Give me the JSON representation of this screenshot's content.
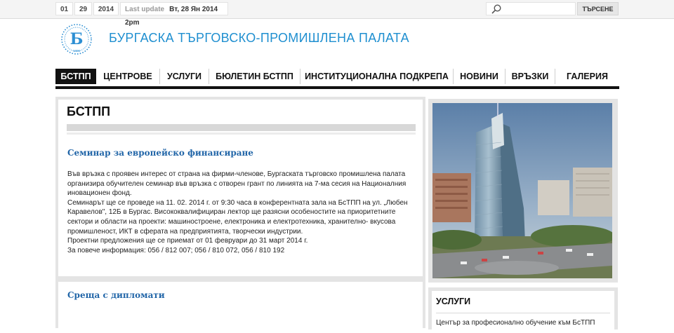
{
  "topbar": {
    "day": "01",
    "month": "29",
    "year": "2014",
    "last_update_label": "Last update",
    "last_update_value": "Вт, 28 Ян 2014 2pm",
    "search_placeholder": "",
    "search_button": "ТЪРСЕНЕ"
  },
  "header": {
    "site_title": "БУРГАСКА ТЪРГОВСКО-ПРОМИШЛЕНА ПАЛАТА",
    "logo_year": "1895"
  },
  "nav": {
    "items": [
      {
        "label": "БСТПП",
        "active": true
      },
      {
        "label": "ЦЕНТРОВЕ"
      },
      {
        "label": "УСЛУГИ"
      },
      {
        "label": "БЮЛЕТИН БСТПП"
      },
      {
        "label": "ИНСТИТУЦИОНАЛНА ПОДКРЕПА"
      },
      {
        "label": "НОВИНИ"
      },
      {
        "label": "ВРЪЗКИ"
      },
      {
        "label": "ГАЛЕРИЯ"
      }
    ]
  },
  "main": {
    "page_title": "БСТПП",
    "articles": [
      {
        "title": "Семинар за европейско финансиране",
        "body_lines": [
          "Във връзка с проявен интерес от страна на фирми-членове, Бургаската търговско промишлена палата",
          "организира обучителен семинар във връзка с отворен грант по линията на 7-ма сесия на Националния",
          "иновационен фонд.",
          "Семинарът ще се проведе на 11. 02. 2014 г. от 9:30 часа в конферентната зала на БсТПП на ул. „Любен",
          "Каравелов\", 12Б в Бургас. Висококвалифициран лектор ще разясни особеностите на приоритетните",
          "сектори и области на проекти: машиностроене, електроника и електротехника, хранително- вкусова",
          "промишленост, ИКТ в сферата на предприятията, творчески индустрии.",
          "Проектни предложения ще се приемат от 01 февруари до 31 март 2014 г.",
          "За повече информация: 056 / 812 007; 056 / 810 072, 056 / 810 192"
        ]
      },
      {
        "title": "Среща с дипломати",
        "body_lines": []
      }
    ]
  },
  "sidebar": {
    "photo_alt": "building-photo",
    "services_heading": "УСЛУГИ",
    "services_first_link": "Център за професионално обучение към БсТПП"
  },
  "colors": {
    "brand_blue": "#1f8fd0",
    "article_title": "#2266a8",
    "nav_active_bg": "#111111"
  }
}
